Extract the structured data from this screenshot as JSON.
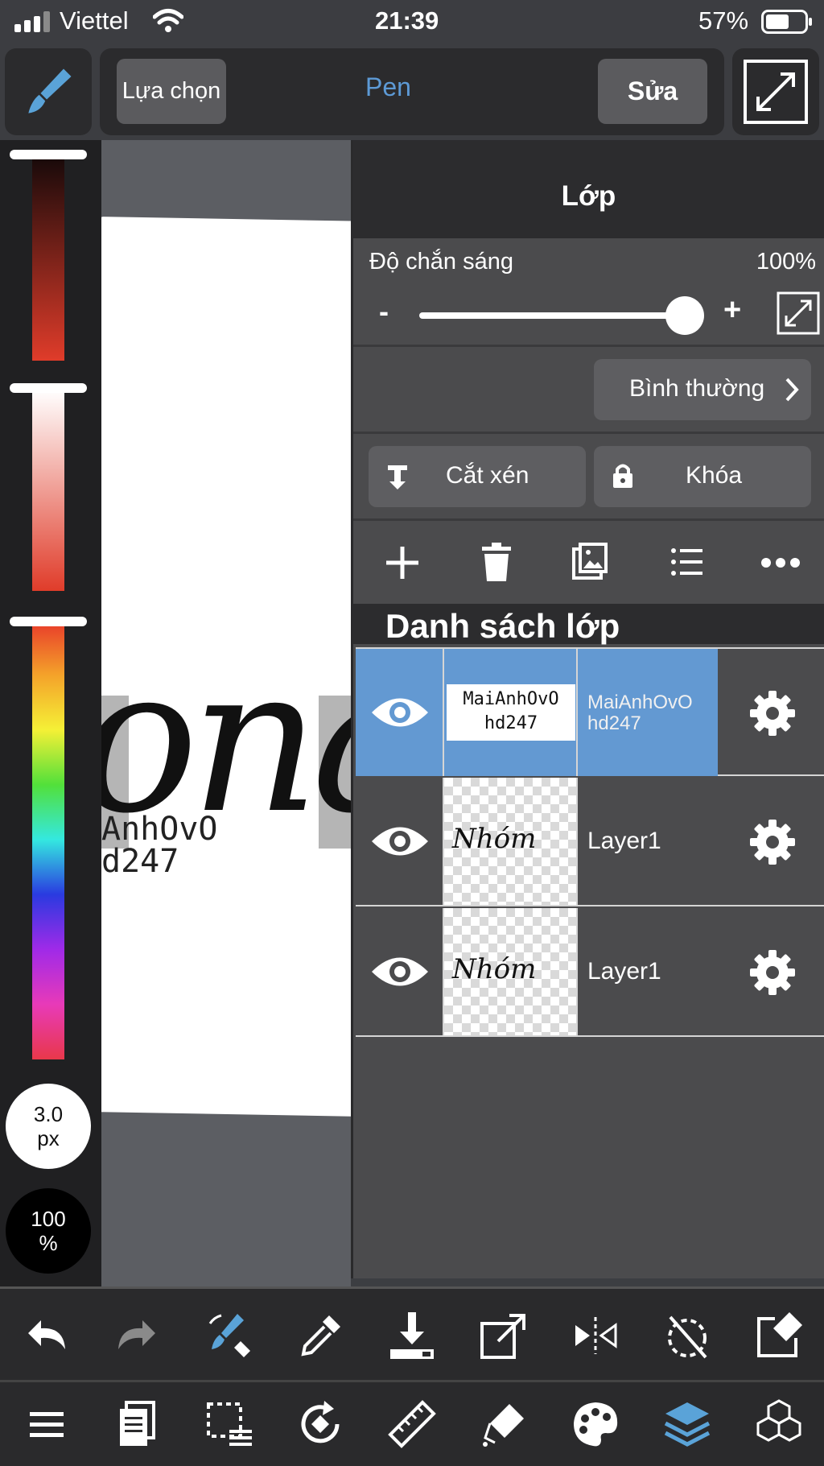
{
  "status": {
    "carrier": "Viettel",
    "time": "21:39",
    "battery": "57%"
  },
  "toolbar": {
    "select_label": "Lựa chọn",
    "tool_label": "Pen",
    "edit_label": "Sửa"
  },
  "palette": {
    "brush_size": "3.0",
    "brush_unit": "px",
    "opacity_value": "100",
    "opacity_unit": "%"
  },
  "canvas": {
    "artwork_text": "ona",
    "watermark_line1": "AnhOvO",
    "watermark_line2": "d247"
  },
  "layer_panel": {
    "title": "Lớp",
    "opacity_label": "Độ chắn sáng",
    "opacity_value": "100%",
    "opacity_level": 1.0,
    "minus": "-",
    "plus": "+",
    "blend_mode": "Bình thường",
    "clip_label": "Cắt xén",
    "lock_label": "Khóa",
    "list_title": "Danh sách lớp",
    "layers": [
      {
        "name": "MaiAnhOvOhd247",
        "name_line1": "MaiAnhOvO",
        "name_line2": "hd247",
        "thumb_line1": "MaiAnhOvO",
        "thumb_line2": "hd247",
        "selected": true
      },
      {
        "name": "Layer1",
        "thumb_text": "Nhóm",
        "selected": false
      },
      {
        "name": "Layer1",
        "thumb_text": "Nhóm",
        "selected": false
      }
    ]
  },
  "colors": {
    "accent": "#5a8fcf",
    "selected_row": "#6399d2",
    "panel": "#4b4b4d",
    "toolbar": "#2a2a2c"
  }
}
